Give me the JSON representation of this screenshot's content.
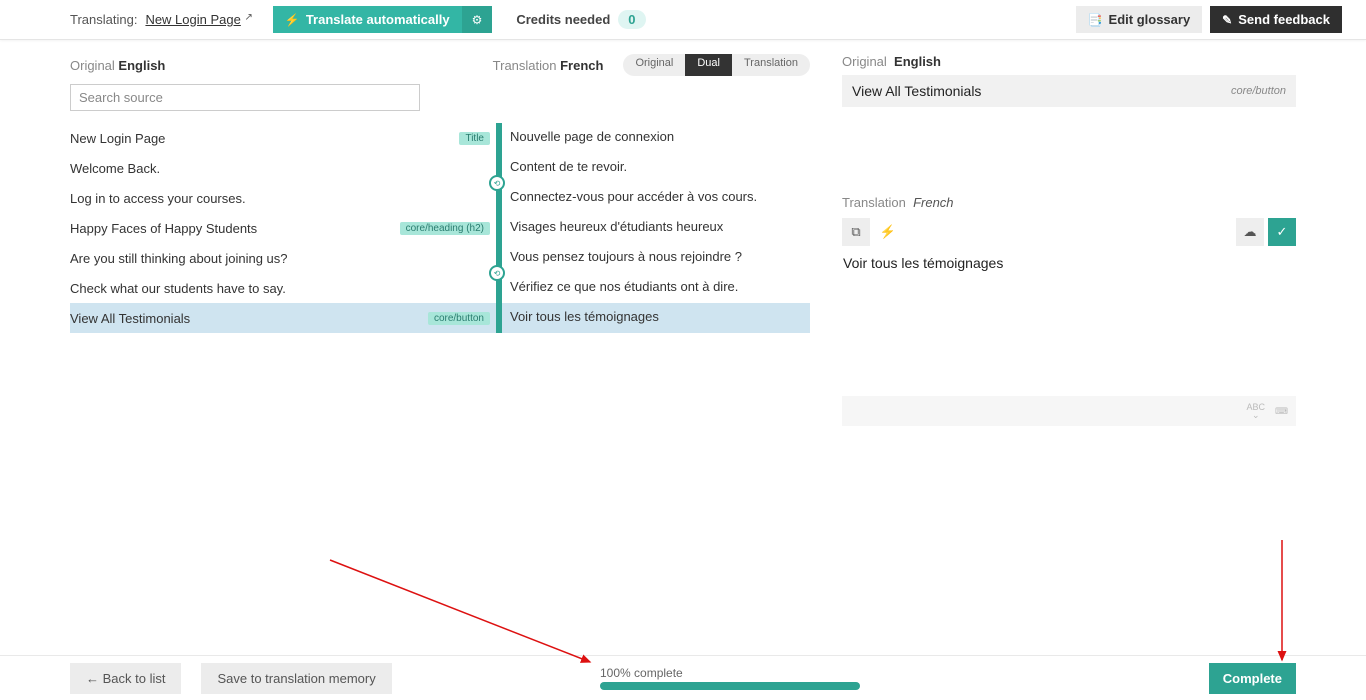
{
  "header": {
    "translating_label": "Translating:",
    "page_name": "New Login Page",
    "translate_auto": "Translate automatically",
    "credits_label": "Credits needed",
    "credits_value": "0",
    "edit_glossary": "Edit glossary",
    "send_feedback": "Send feedback"
  },
  "left": {
    "orig_label": "Original",
    "orig_lang": "English",
    "trans_label": "Translation",
    "trans_lang": "French",
    "search_placeholder": "Search source",
    "pills": {
      "original": "Original",
      "dual": "Dual",
      "translation": "Translation"
    }
  },
  "rows": [
    {
      "src": "New Login Page",
      "tag": "Title",
      "tgt": "Nouvelle page de connexion",
      "link": false,
      "selected": false
    },
    {
      "src": "Welcome Back.",
      "tag": "",
      "tgt": "Content de te revoir.",
      "link": false,
      "selected": false
    },
    {
      "src": "Log in to access your courses.",
      "tag": "",
      "tgt": "Connectez-vous pour accéder à vos cours.",
      "link": true,
      "selected": false
    },
    {
      "src": "Happy Faces of Happy Students",
      "tag": "core/heading (h2)",
      "tgt": "Visages heureux d'étudiants heureux",
      "link": false,
      "selected": false
    },
    {
      "src": "Are you still thinking about joining us?",
      "tag": "",
      "tgt": "Vous pensez toujours à nous rejoindre ?",
      "link": false,
      "selected": false
    },
    {
      "src": "Check what our students have to say.",
      "tag": "",
      "tgt": "Vérifiez ce que nos étudiants ont à dire.",
      "link": true,
      "selected": false
    },
    {
      "src": "View All Testimonials",
      "tag": "core/button",
      "tgt": "Voir tous les témoignages",
      "link": false,
      "selected": true
    }
  ],
  "right": {
    "orig_label": "Original",
    "orig_lang": "English",
    "orig_text": "View All Testimonials",
    "orig_tag": "core/button",
    "trans_label": "Translation",
    "trans_lang": "French",
    "trans_text": "Voir tous les témoignages",
    "abc_label": "ABC"
  },
  "footer": {
    "back": "← Back to list",
    "save_tm": "Save to translation memory",
    "progress_text": "100% complete",
    "complete": "Complete"
  }
}
